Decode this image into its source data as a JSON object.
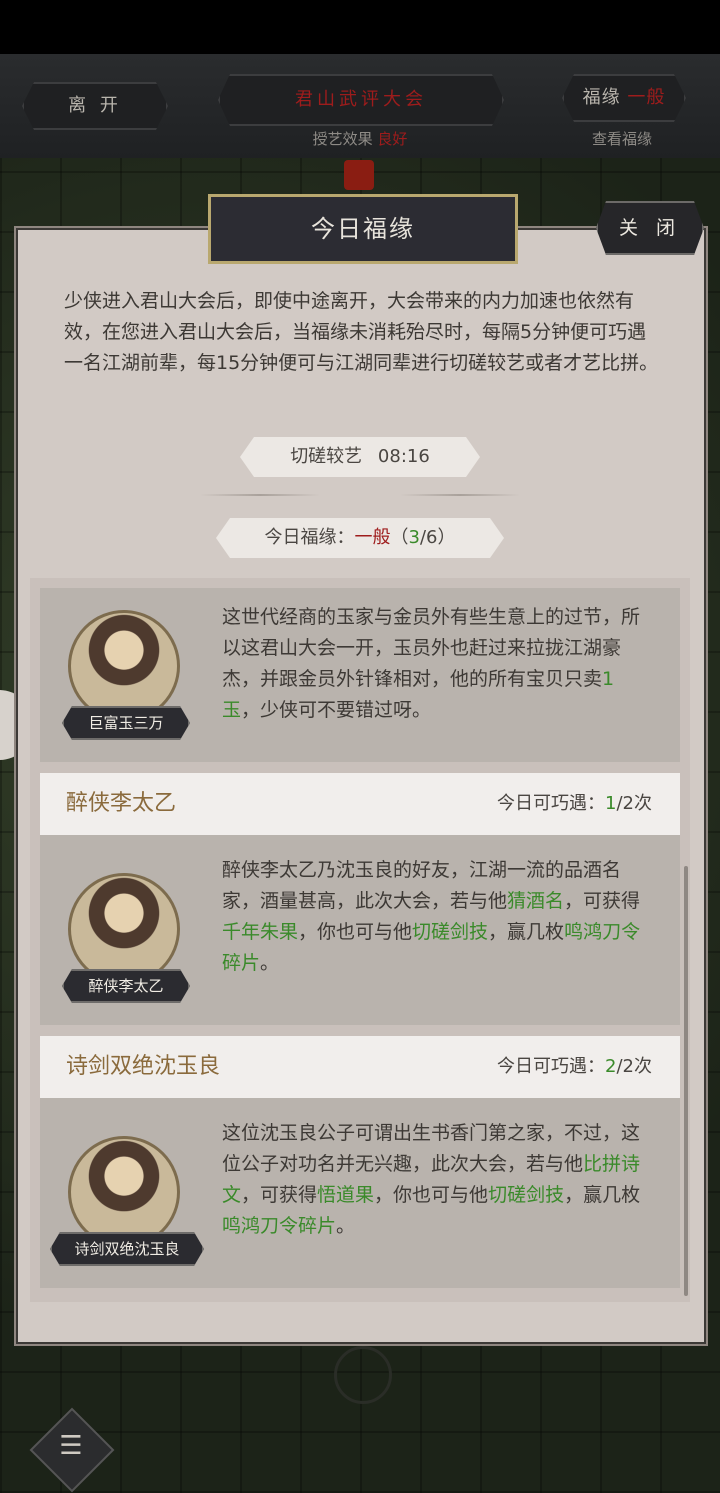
{
  "topbar": {
    "leave_label": "离 开",
    "event_title": "君山武评大会",
    "event_effect_prefix": "授艺效果",
    "event_effect_value": "良好",
    "fortune_label": "福缘",
    "fortune_value": "一般",
    "fortune_link": "查看福缘"
  },
  "panel": {
    "title": "今日福缘",
    "close_label": "关 闭",
    "description": "少侠进入君山大会后，即使中途离开，大会带来的内力加速也依然有效，在您进入君山大会后，当福缘未消耗殆尽时，每隔5分钟便可巧遇一名江湖前辈，每15分钟便可与江湖同辈进行切磋较艺或者才艺比拼。",
    "spar_label": "切磋较艺",
    "spar_timer": "08:16",
    "fortune_label": "今日福缘：",
    "fortune_level": "一般",
    "fortune_used": "3",
    "fortune_total": "/6",
    "fortune_open": "（",
    "fortune_close": "）"
  },
  "npcs": [
    {
      "name": "巨富玉三万",
      "desc_1": "这世代经商的玉家与金员外有些生意上的过节，所以这君山大会一开，玉员外也赶过来拉拢江湖豪杰，并跟金员外针锋相对，他的所有宝贝只卖",
      "desc_highlight": "1玉",
      "desc_2": "，少侠可不要错过呀。"
    },
    {
      "name": "醉侠李太乙",
      "count_label": "今日可巧遇：",
      "count_used": "1",
      "count_total": "/2次",
      "desc_1": "醉侠李太乙乃沈玉良的好友，江湖一流的品酒名家，酒量甚高，此次大会，若与他",
      "h1": "猜酒名",
      "desc_2": "，可获得",
      "h2": "千年朱果",
      "desc_3": "，你也可与他",
      "h3": "切磋剑技",
      "desc_4": "，赢几枚",
      "h4": "鸣鸿刀令碎片",
      "desc_5": "。"
    },
    {
      "name": "诗剑双绝沈玉良",
      "count_label": "今日可巧遇：",
      "count_used": "2",
      "count_total": "/2次",
      "desc_1": "这位沈玉良公子可谓出生书香门第之家，不过，这位公子对功名并无兴趣，此次大会，若与他",
      "h1": "比拼诗文",
      "desc_2": "，可获得",
      "h2": "悟道果",
      "desc_3": "，你也可与他",
      "h3": "切磋剑技",
      "desc_4": "，赢几枚",
      "h4": "鸣鸿刀令碎片",
      "desc_5": "。"
    }
  ],
  "colors": {
    "highlight_green": "#3a8a2a",
    "warning_red": "#9e1c1c",
    "npc_name": "#8a6a3c"
  }
}
